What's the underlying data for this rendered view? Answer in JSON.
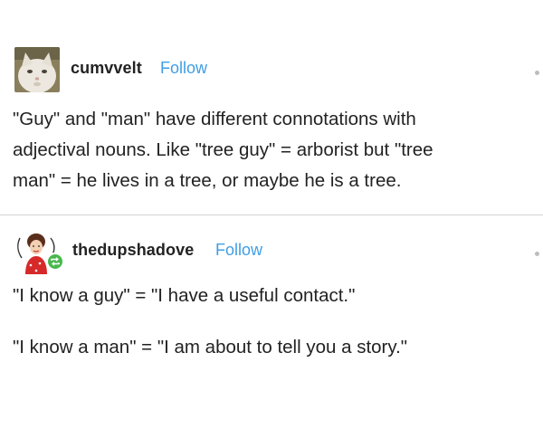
{
  "posts": [
    {
      "username": "cumvvelt",
      "follow_label": "Follow",
      "avatar_icon": "cat-avatar",
      "lines": [
        "\"Guy\" and \"man\" have different connotations with",
        "adjectival nouns. Like \"tree guy\" = arborist but \"tree",
        "man\" = he lives in a tree, or maybe he is a tree."
      ]
    },
    {
      "username": "thedupshadove",
      "follow_label": "Follow",
      "avatar_icon": "woman-avatar",
      "badge_icon": "reblog-icon",
      "lines": [
        "\"I know a guy\" = \"I have a useful contact.\"",
        "\"I know a man\" = \"I am about to tell you a story.\""
      ]
    }
  ],
  "colors": {
    "link": "#3f9ee6",
    "text": "#222222",
    "divider": "#d4d4d4",
    "badge": "#48b84d"
  }
}
